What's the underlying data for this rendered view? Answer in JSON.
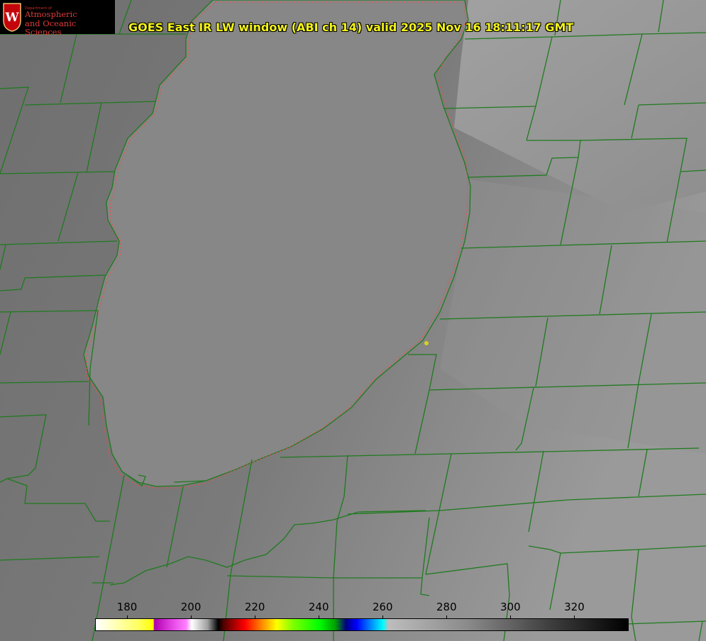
{
  "header": {
    "title": "GOES East IR LW window (ABI ch 14) valid 2025 Nov 16 18:11:17 GMT"
  },
  "logo": {
    "department": "Department of",
    "line1": "Atmospheric",
    "line2": "and Oceanic Sciences",
    "seal_letter": "W"
  },
  "colorbar": {
    "ticks": [
      "180",
      "200",
      "220",
      "240",
      "260",
      "280",
      "300",
      "320"
    ]
  },
  "colors": {
    "background": "#7a7a7a",
    "lake": "#878787",
    "borders": "#1f7a1f",
    "shoreline": "#ff4444",
    "title": "#f5f519",
    "marker": "#d8d020"
  }
}
